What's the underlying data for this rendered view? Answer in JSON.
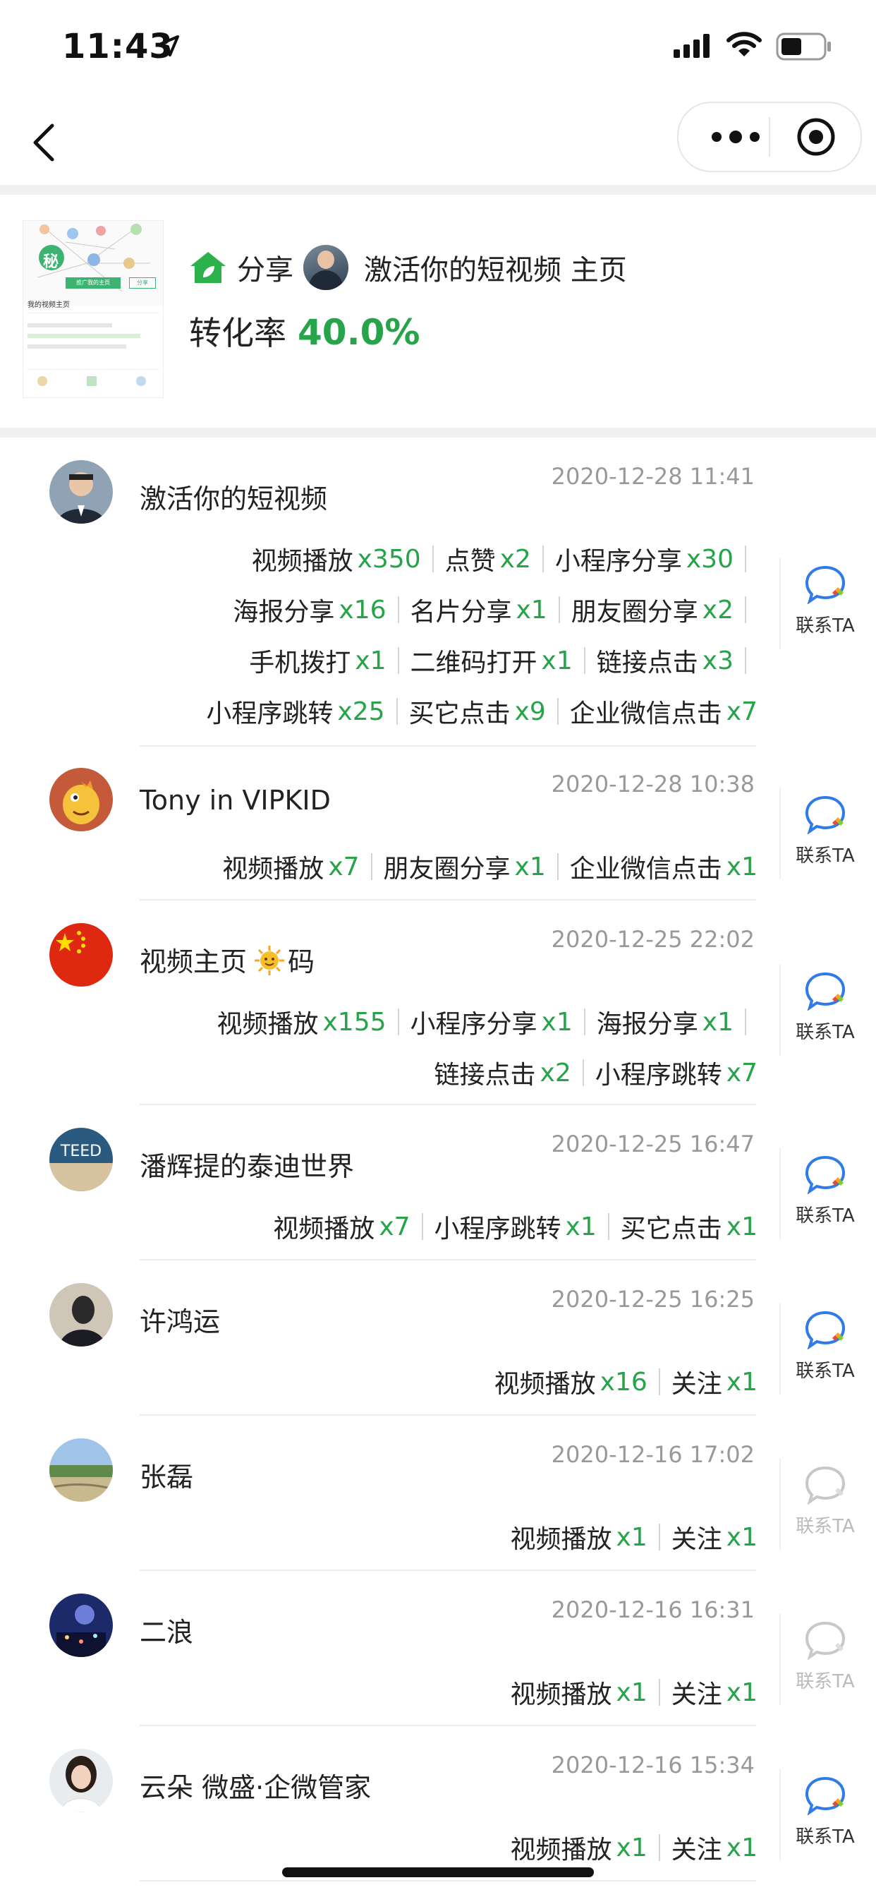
{
  "status_bar": {
    "time": "11:43"
  },
  "header": {
    "share_label": "分享",
    "title": "激活你的短视频 主页",
    "conversion_label": "转化率",
    "conversion_value": "40.0%",
    "thumb": {
      "caption": "我的视频主页",
      "button1": "推广我的主页",
      "button2": "分享",
      "badge": "秘"
    }
  },
  "contact_label": "联系TA",
  "colors": {
    "accent": "#27a34a",
    "contact_blue": "#2f7be8"
  },
  "list": [
    {
      "name": "激活你的短视频",
      "time": "2020-12-28 11:41",
      "avatar": "photo-man-suit",
      "contact_enabled": true,
      "stat_lines": [
        [
          {
            "label": "视频播放",
            "count": "x350"
          },
          {
            "label": "点赞",
            "count": "x2"
          },
          {
            "label": "小程序分享",
            "count": "x30"
          }
        ],
        [
          {
            "label": "海报分享",
            "count": "x16"
          },
          {
            "label": "名片分享",
            "count": "x1"
          },
          {
            "label": "朋友圈分享",
            "count": "x2"
          }
        ],
        [
          {
            "label": "手机拨打",
            "count": "x1"
          },
          {
            "label": "二维码打开",
            "count": "x1"
          },
          {
            "label": "链接点击",
            "count": "x3"
          }
        ],
        [
          {
            "label": "小程序跳转",
            "count": "x25"
          },
          {
            "label": "买它点击",
            "count": "x9"
          },
          {
            "label": "企业微信点击",
            "count": "x7"
          }
        ]
      ]
    },
    {
      "name": "Tony in VIPKID",
      "time": "2020-12-28 10:38",
      "avatar": "cartoon-dinosaur",
      "contact_enabled": true,
      "stat_lines": [
        [
          {
            "label": "视频播放",
            "count": "x7"
          },
          {
            "label": "朋友圈分享",
            "count": "x1"
          },
          {
            "label": "企业微信点击",
            "count": "x1"
          }
        ]
      ]
    },
    {
      "name": "视频主页",
      "name_suffix": "码",
      "time": "2020-12-25 22:02",
      "avatar": "china-flag",
      "contact_enabled": true,
      "stat_lines": [
        [
          {
            "label": "视频播放",
            "count": "x155"
          },
          {
            "label": "小程序分享",
            "count": "x1"
          },
          {
            "label": "海报分享",
            "count": "x1"
          }
        ],
        [
          {
            "label": "链接点击",
            "count": "x2"
          },
          {
            "label": "小程序跳转",
            "count": "x7"
          }
        ]
      ]
    },
    {
      "name": "潘辉提的泰迪世界",
      "time": "2020-12-25 16:47",
      "avatar": "teddy-logo",
      "contact_enabled": true,
      "stat_lines": [
        [
          {
            "label": "视频播放",
            "count": "x7"
          },
          {
            "label": "小程序跳转",
            "count": "x1"
          },
          {
            "label": "买它点击",
            "count": "x1"
          }
        ]
      ]
    },
    {
      "name": "许鸿运",
      "time": "2020-12-25 16:25",
      "avatar": "dark-portrait",
      "contact_enabled": true,
      "stat_lines": [
        [
          {
            "label": "视频播放",
            "count": "x16"
          },
          {
            "label": "关注",
            "count": "x1"
          }
        ]
      ]
    },
    {
      "name": "张磊",
      "time": "2020-12-16 17:02",
      "avatar": "landscape",
      "contact_enabled": false,
      "stat_lines": [
        [
          {
            "label": "视频播放",
            "count": "x1"
          },
          {
            "label": "关注",
            "count": "x1"
          }
        ]
      ]
    },
    {
      "name": "二浪",
      "time": "2020-12-16 16:31",
      "avatar": "night-city",
      "contact_enabled": false,
      "stat_lines": [
        [
          {
            "label": "视频播放",
            "count": "x1"
          },
          {
            "label": "关注",
            "count": "x1"
          }
        ]
      ]
    },
    {
      "name": "云朵 微盛·企微管家",
      "time": "2020-12-16 15:34",
      "avatar": "woman-portrait",
      "contact_enabled": true,
      "stat_lines": [
        [
          {
            "label": "视频播放",
            "count": "x1"
          },
          {
            "label": "关注",
            "count": "x1"
          }
        ]
      ]
    }
  ]
}
